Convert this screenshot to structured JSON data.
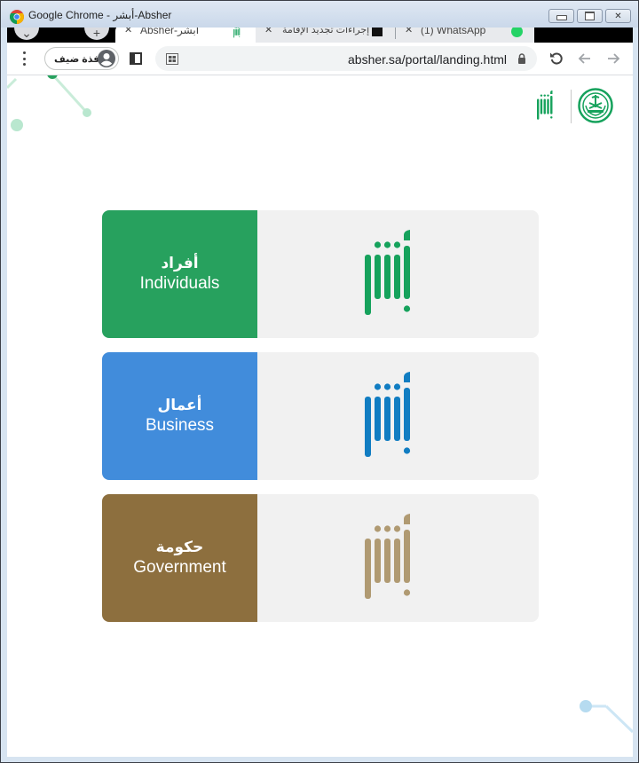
{
  "window": {
    "title": "Google Chrome - أبشر-Absher",
    "controls": {
      "minimize": "minimize",
      "maximize": "maximize",
      "close": "close"
    }
  },
  "tabs": [
    {
      "label": "Absher-أبشر",
      "active": true,
      "favicon": "absher-logo-icon"
    },
    {
      "label": "إجراءات تجديد الإقامة",
      "active": false,
      "favicon": "document-icon"
    },
    {
      "label": "(1) WhatsApp",
      "active": false,
      "favicon": "whatsapp-icon"
    }
  ],
  "toolbar": {
    "profile_label": "نافذة ضيف",
    "url": "absher.sa/portal/landing.html"
  },
  "colors": {
    "individuals": "#27a15e",
    "business": "#418cdb",
    "government": "#8d6f3e",
    "logo_green": "#16a25c",
    "logo_blue": "#117dc2",
    "logo_gold": "#b09a72",
    "card_bg": "#f1f1f1"
  },
  "cards": [
    {
      "key": "individuals",
      "label_ar": "أفراد",
      "label_en": "Individuals",
      "logo": "absher-logo-green"
    },
    {
      "key": "business",
      "label_ar": "أعمال",
      "label_en": "Business",
      "logo": "absher-logo-blue"
    },
    {
      "key": "government",
      "label_ar": "حكومة",
      "label_en": "Government",
      "logo": "absher-logo-gold"
    }
  ]
}
